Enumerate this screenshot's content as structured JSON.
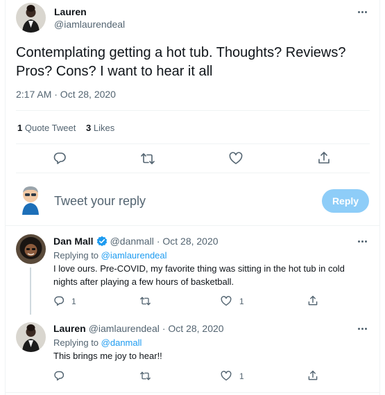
{
  "main_tweet": {
    "author_name": "Lauren",
    "author_handle": "@iamlaurendeal",
    "text": "Contemplating getting a hot tub. Thoughts? Reviews? Pros? Cons? I want to hear it all",
    "timestamp": "2:17 AM · Oct 28, 2020",
    "quote_count": "1",
    "quote_label": "Quote Tweet",
    "like_count": "3",
    "like_label": "Likes"
  },
  "compose": {
    "placeholder": "Tweet your reply",
    "reply_button": "Reply"
  },
  "replies": [
    {
      "author_name": "Dan Mall",
      "verified": true,
      "author_handle": "@danmall",
      "date": "· Oct 28, 2020",
      "replying_prefix": "Replying to ",
      "replying_to": "@iamlaurendeal",
      "text_line1": "I love ours. Pre-COVID, my favorite thing was sitting in the hot tub in cold",
      "text_line2": "nights after playing a few hours of basketball.",
      "reply_count": "1",
      "like_count": "1"
    },
    {
      "author_name": "Lauren",
      "author_handle": "@iamlaurendeal",
      "date": "· Oct 28, 2020",
      "replying_prefix": "Replying to ",
      "replying_to": "@danmall",
      "text_line1": "This brings me joy to hear!!",
      "like_count": "1"
    }
  ],
  "colors": {
    "accent": "#1d9bf0",
    "reply_button_disabled": "#8ecdf8",
    "secondary_text": "#536471",
    "divider": "#eff3f4"
  },
  "icons": [
    "reply-icon",
    "retweet-icon",
    "like-icon",
    "share-icon",
    "more-icon",
    "verified-badge-icon"
  ]
}
